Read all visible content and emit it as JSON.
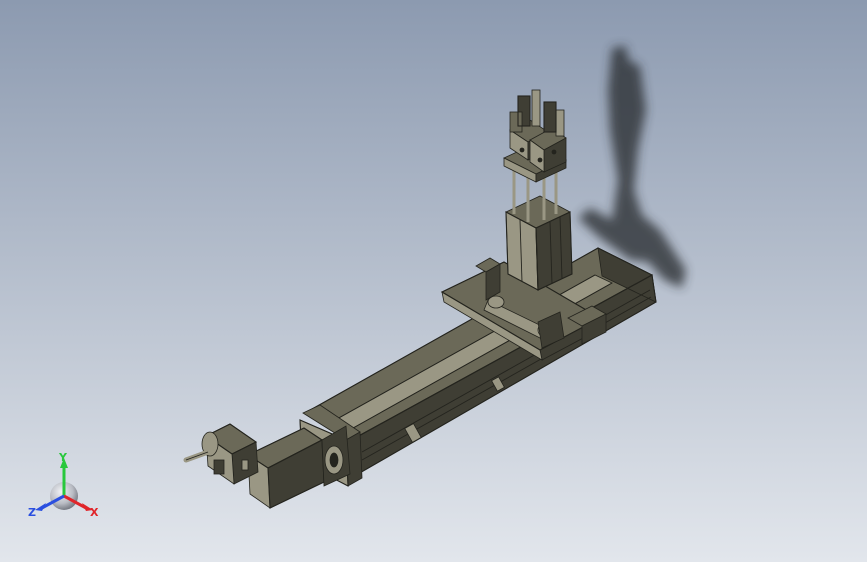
{
  "viewport": {
    "background_top": "#8c9ab0",
    "background_bottom": "#e2e6ec"
  },
  "model": {
    "body_color": "#6b6958",
    "dark_color": "#3f3e34",
    "light_color": "#9a9784",
    "edge_color": "#24241e",
    "shadow_color": "#2b2d32"
  },
  "triad": {
    "x_label": "X",
    "y_label": "Y",
    "z_label": "Z",
    "x_color": "#e0252a",
    "y_color": "#28c83c",
    "z_color": "#2a4fe0",
    "sphere_color": "#b9bcc4"
  }
}
